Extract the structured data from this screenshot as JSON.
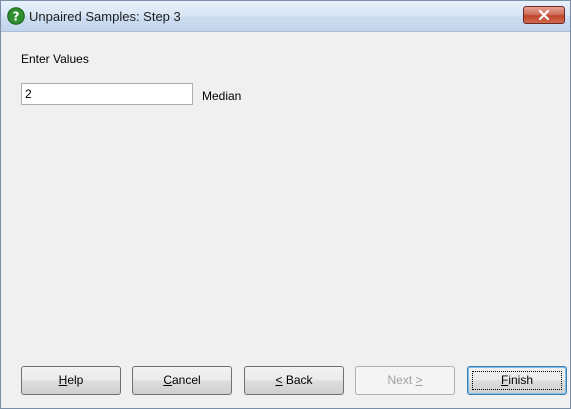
{
  "window": {
    "title": "Unpaired Samples: Step 3",
    "title_icon": "help-question-icon",
    "close_icon": "close-icon"
  },
  "form": {
    "section_label": "Enter Values",
    "value": "2",
    "value_label": "Median"
  },
  "buttons": {
    "help": {
      "prefix": "",
      "mnemonic": "H",
      "rest": "elp"
    },
    "cancel": {
      "prefix": "",
      "mnemonic": "C",
      "rest": "ancel"
    },
    "back": {
      "prefix": "",
      "mnemonic": "<",
      "rest": " Back"
    },
    "next": {
      "prefix": "Next ",
      "mnemonic": ">",
      "rest": ""
    },
    "finish": {
      "prefix": "",
      "mnemonic": "F",
      "rest": "inish"
    }
  },
  "colors": {
    "accent_icon": "#2f8f2f",
    "close_button": "#c0452d",
    "dialog_background": "#f0f0f0"
  }
}
